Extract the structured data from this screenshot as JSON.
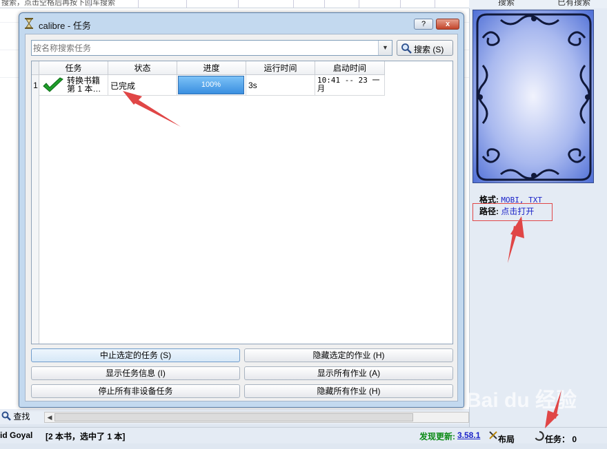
{
  "background": {
    "top_hint": "搜索，点击空格后再按下回车搜索",
    "right_buttons": [
      "搜索",
      "已有搜索"
    ],
    "find_label": "查找",
    "book_meta": {
      "format_label": "格式:",
      "format_value": "MOBI, TXT",
      "path_label": "路径:",
      "path_value": "点击打开"
    }
  },
  "status_bar": {
    "author": "id Goyal",
    "selection": "[2 本书，选中了 1 本]",
    "update_label": "发现更新:",
    "update_version": "3.58.1",
    "layout_label": "布局",
    "jobs_label": "任务：  0"
  },
  "dialog": {
    "title": "calibre - 任务",
    "help_label": "?",
    "close_label": "x",
    "search": {
      "placeholder": "按名称搜索任务",
      "button_label": "搜索 (S)"
    },
    "table": {
      "columns": [
        "任务",
        "状态",
        "进度",
        "运行时间",
        "启动时间"
      ],
      "rows": [
        {
          "index": "1",
          "task_line1": "转换书籍",
          "task_line2": "第 1 本…",
          "status": "已完成",
          "progress_text": "100%",
          "progress": 1.0,
          "runtime": "3s",
          "start_line1": "10:41 -- 23 一",
          "start_line2": "月"
        }
      ]
    },
    "buttons": {
      "abort_selected": "中止选定的任务 (S)",
      "hide_selected": "隐藏选定的作业 (H)",
      "show_info": "显示任务信息 (I)",
      "show_all": "显示所有作业 (A)",
      "stop_non_device": "停止所有非设备任务",
      "hide_all": "隐藏所有作业 (H)"
    }
  },
  "watermark": "Bai du 经验",
  "colors": {
    "dialog_frame": "#c3d9ef",
    "progress_fill": "#3a8fe0",
    "annotation_red": "#e04646",
    "update_green": "#0b8a16",
    "link_blue": "#1a22c8"
  }
}
